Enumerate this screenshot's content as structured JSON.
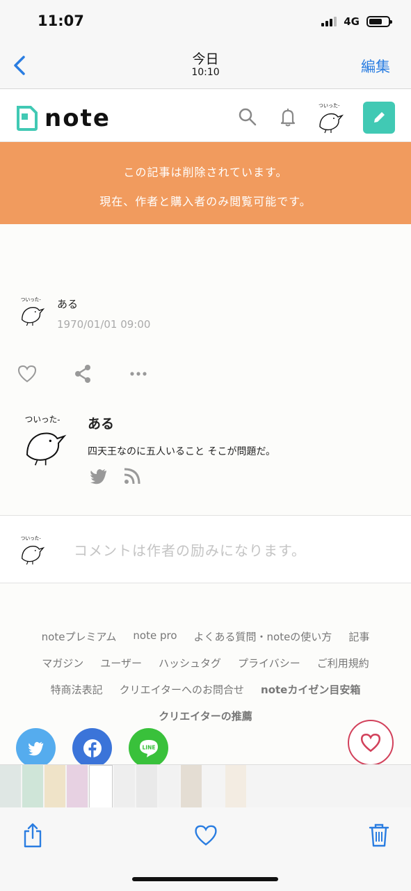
{
  "status_bar": {
    "time": "11:07",
    "network": "4G"
  },
  "photos_nav": {
    "back_icon": "chevron-left-icon",
    "title": "今日",
    "subtitle": "10:10",
    "edit_label": "編集"
  },
  "note_header": {
    "logo_text": "note",
    "icons": [
      "search-icon",
      "bell-icon",
      "avatar",
      "pencil-icon"
    ]
  },
  "banner": {
    "line1": "この記事は削除されています。",
    "line2": "現在、作者と購入者のみ閲覧可能です。",
    "color": "#f19b5e"
  },
  "article": {
    "author_name": "ある",
    "date": "1970/01/01 09:00"
  },
  "profile": {
    "name": "ある",
    "bio": "四天王なのに五人いること そこが問題だ。",
    "avatar_text": "ついった-"
  },
  "comment": {
    "placeholder": "コメントは作者の励みになります。"
  },
  "footer": {
    "rows": [
      [
        "noteプレミアム",
        "note pro",
        "よくある質問・noteの使い方",
        "記事"
      ],
      [
        "マガジン",
        "ユーザー",
        "ハッシュタグ",
        "プライバシー",
        "ご利用規約"
      ],
      [
        "特商法表記",
        "クリエイターへのお問合せ",
        "noteカイゼン目安箱"
      ],
      [
        "クリエイターの推薦"
      ]
    ],
    "bold_links": [
      "noteカイゼン目安箱",
      "クリエイターの推薦"
    ],
    "share_buttons": [
      {
        "name": "twitter",
        "color": "#55acee"
      },
      {
        "name": "facebook",
        "color": "#3b74d9"
      },
      {
        "name": "line",
        "color": "#39c13b",
        "label": "LINE"
      }
    ]
  },
  "toolbar": {
    "icons": [
      "share-icon",
      "heart-icon",
      "trash-icon"
    ]
  },
  "colors": {
    "accent_blue": "#2a7de1",
    "note_green": "#41c9b4",
    "like_red": "#d2415b"
  }
}
